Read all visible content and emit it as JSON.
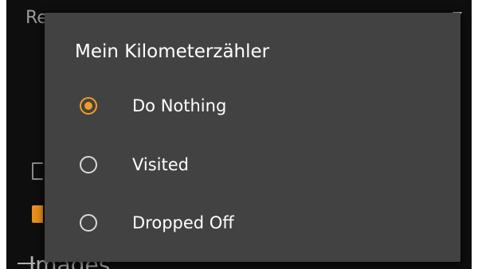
{
  "background": {
    "top_label_fragment": "Re",
    "section_label": "Images",
    "dropdown_icon": "triangle-down-icon",
    "accent_color": "#e9901d"
  },
  "dialog": {
    "title": "Mein Kilometerzähler",
    "options": [
      {
        "label": "Do Nothing",
        "selected": true
      },
      {
        "label": "Visited",
        "selected": false
      },
      {
        "label": "Dropped Off",
        "selected": false
      }
    ],
    "radio_selected_color": "#f39c23",
    "radio_unselected_color": "#d9d9d9",
    "background_color": "#424242"
  }
}
